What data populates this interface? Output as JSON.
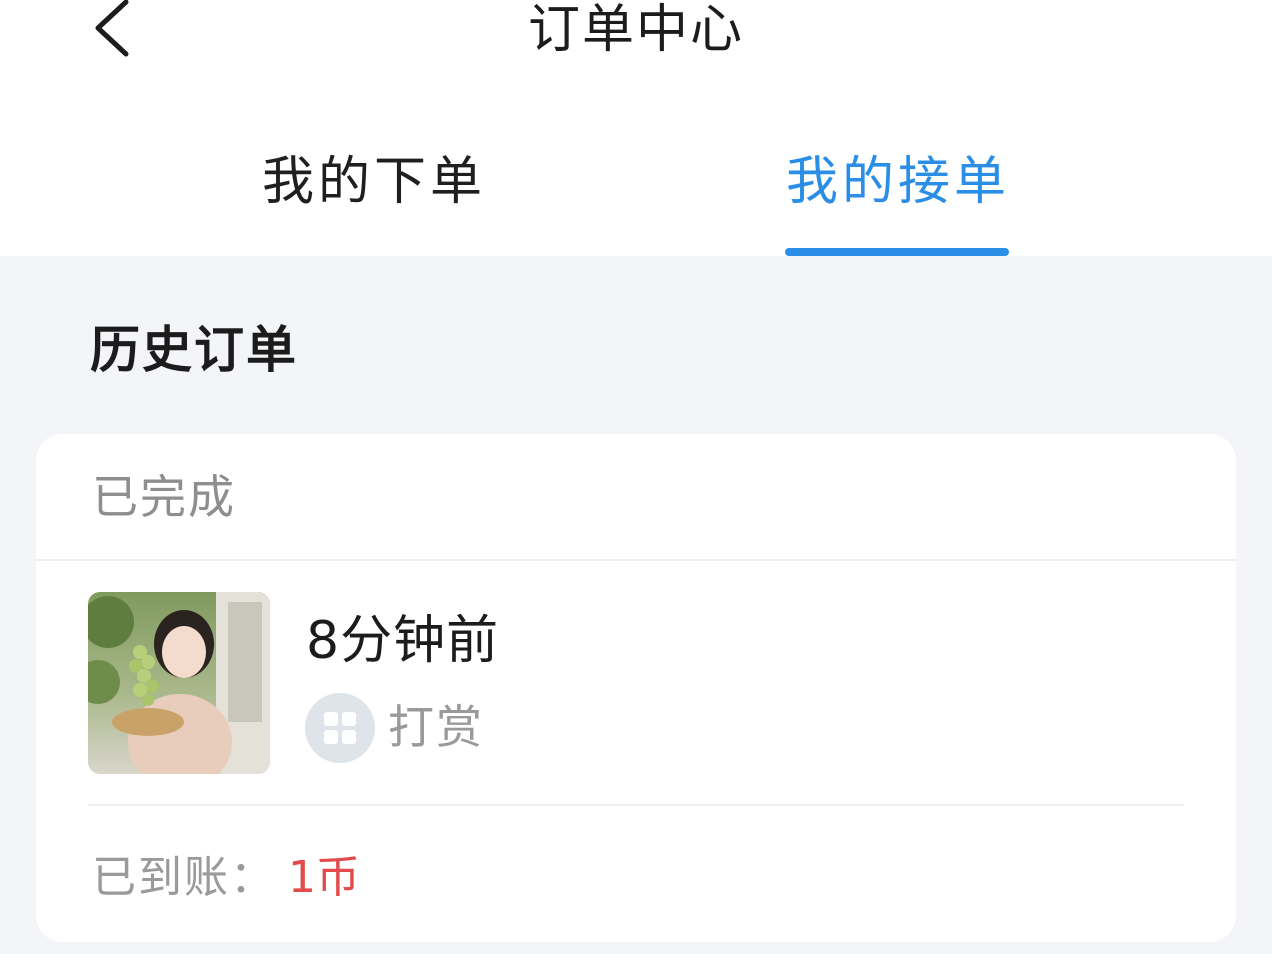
{
  "header": {
    "title": "订单中心",
    "back_icon": "chevron-left-icon"
  },
  "tabs": [
    {
      "label": "我的下单",
      "active": false
    },
    {
      "label": "我的接单",
      "active": true
    }
  ],
  "colors": {
    "accent": "#2a8ee6",
    "amount": "#e14b4b",
    "page_background": "#f3f5f9"
  },
  "section": {
    "title": "历史订单"
  },
  "order": {
    "status": "已完成",
    "time": "8分钟前",
    "type_label": "打赏",
    "type_icon": "grid-apps-icon",
    "paid_label": "已到账：",
    "paid_amount": "1币"
  }
}
